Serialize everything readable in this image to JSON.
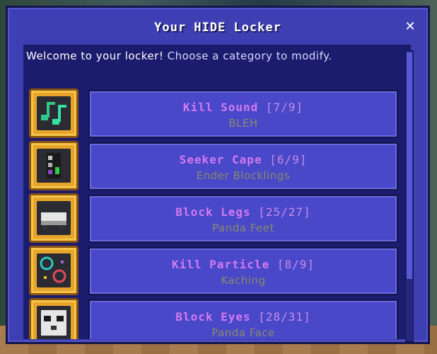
{
  "window": {
    "title": "Your HIDE Locker",
    "close_label": "✕"
  },
  "welcome": {
    "bold": "Welcome to your locker!",
    "rest": " Choose a category to modify."
  },
  "categories": [
    {
      "name": "Kill Sound",
      "count": "[7/9]",
      "selected": "BLEH",
      "icon": "music-note-icon"
    },
    {
      "name": "Seeker Cape",
      "count": "[6/9]",
      "selected": "Ender Blocklings",
      "icon": "cape-icon"
    },
    {
      "name": "Block Legs",
      "count": "[25/27]",
      "selected": "Panda Feet",
      "icon": "block-legs-icon"
    },
    {
      "name": "Kill Particle",
      "count": "[8/9]",
      "selected": "Kaching",
      "icon": "particle-icon"
    },
    {
      "name": "Block Eyes",
      "count": "[28/31]",
      "selected": "Panda Face",
      "icon": "block-eyes-icon"
    }
  ]
}
